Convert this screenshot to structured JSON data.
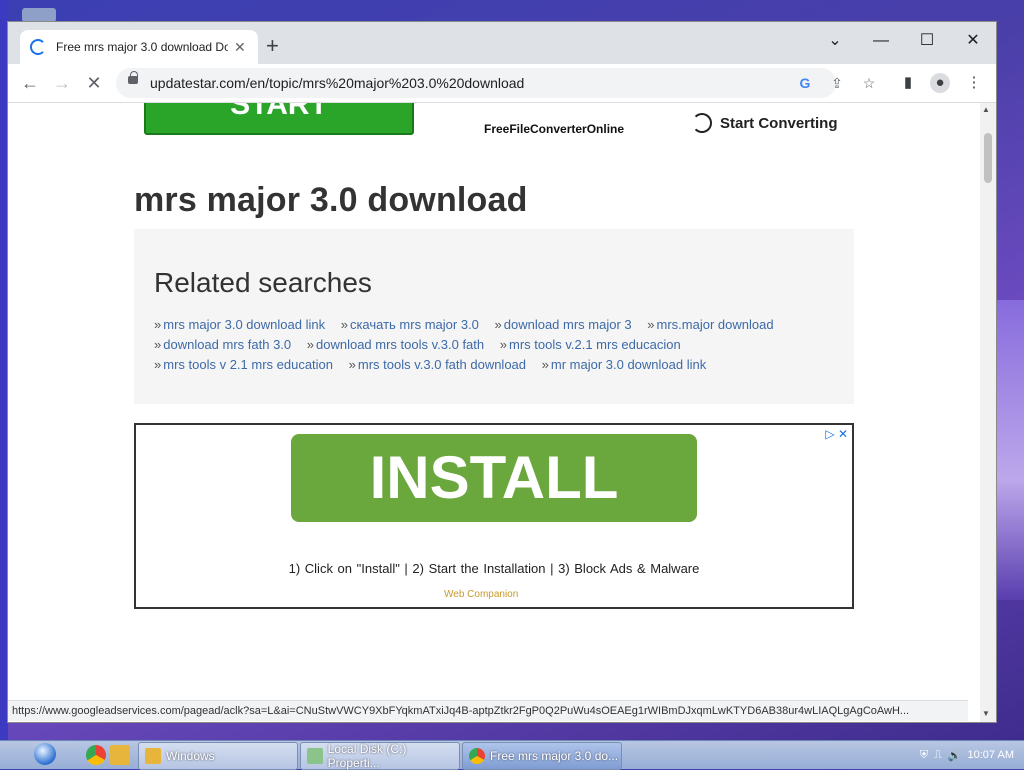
{
  "browser": {
    "tab_title": "Free mrs major 3.0 download Do",
    "tab_close": "✕",
    "new_tab": "+",
    "url": "updatestar.com/en/topic/mrs%20major%203.0%20download",
    "window_buttons": [
      "⌄",
      "—",
      "☐",
      "✕"
    ]
  },
  "page": {
    "start_button": "START",
    "ffc_label": "FreeFileConverterOnline",
    "start_converting": "Start Converting",
    "heading": "mrs major 3.0 download",
    "related": {
      "title": "Related searches",
      "links": [
        "mrs major 3.0 download link",
        "скачать mrs major 3.0",
        "download mrs major 3",
        "mrs.major download",
        "download mrs fath 3.0",
        "download mrs tools v.3.0 fath",
        "mrs tools v.2.1 mrs educacion",
        "mrs tools v 2.1 mrs education",
        "mrs tools v.3.0 fath download",
        "mr major 3.0 download link"
      ]
    },
    "ad": {
      "install": "INSTALL",
      "steps": "1) Click on \"Install\"    |    2) Start the Installation    |    3) Block Ads & Malware",
      "companion": "Web Companion"
    }
  },
  "status_url": "https://www.googleadservices.com/pagead/aclk?sa=L&ai=CNuStwVWCY9XbFYqkmATxiJq4B-aptpZtkr2FgP0Q2PuWu4sOEAEg1rWIBmDJxqmLwKTYD6AB38ur4wLIAQLgAgCoAwH...",
  "taskbar": {
    "tasks": [
      {
        "label": "Windows"
      },
      {
        "label": "Local Disk (C:) Properti..."
      },
      {
        "label": "Free mrs major 3.0 do..."
      }
    ],
    "time": "10:07 AM"
  }
}
